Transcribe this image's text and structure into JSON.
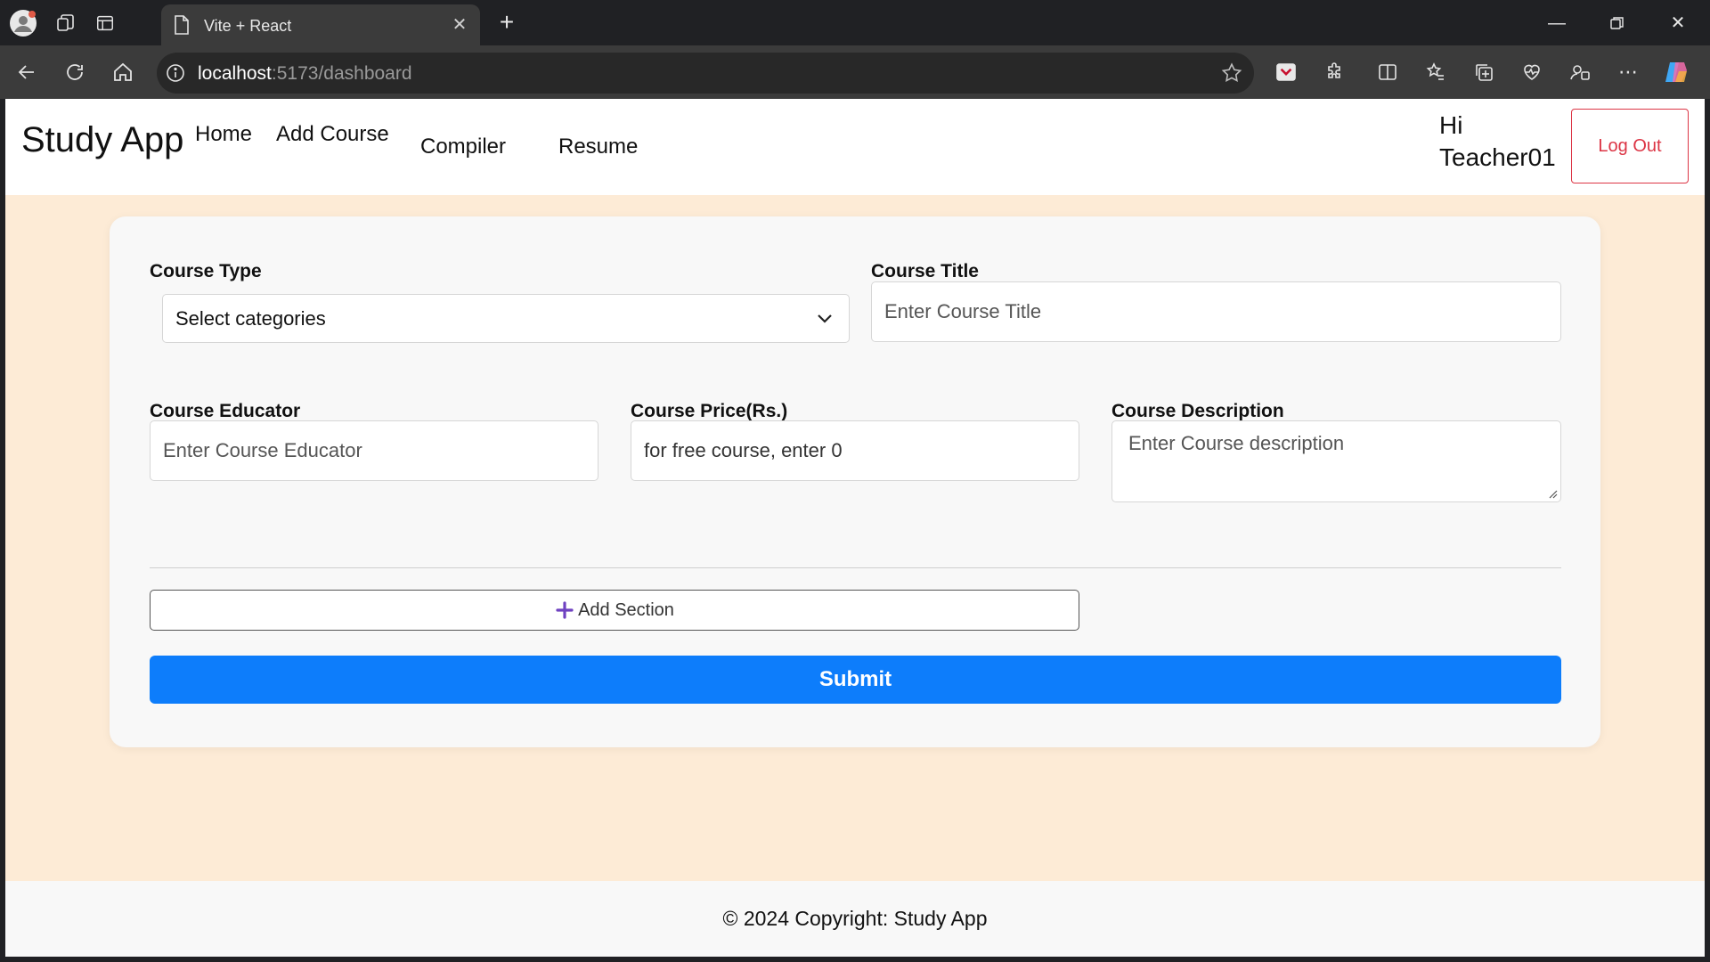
{
  "browser": {
    "tab_title": "Vite + React",
    "url_host": "localhost",
    "url_rest": ":5173/dashboard"
  },
  "navbar": {
    "brand": "Study App",
    "links": [
      "Home",
      "Add Course",
      "Compiler",
      "Resume"
    ],
    "greeting_hi": "Hi",
    "greeting_user": "Teacher01",
    "logout_label": "Log Out"
  },
  "form": {
    "course_type_label": "Course Type",
    "course_type_value": "Select categories",
    "course_title_label": "Course Title",
    "course_title_placeholder": "Enter Course Title",
    "educator_label": "Course Educator",
    "educator_placeholder": "Enter Course Educator",
    "price_label": "Course Price(Rs.)",
    "price_placeholder": "for free course, enter 0",
    "description_label": "Course Description",
    "description_placeholder": "Enter Course description",
    "add_section_label": "Add Section",
    "submit_label": "Submit"
  },
  "footer": {
    "copyright": "© 2024 Copyright: Study App"
  },
  "colors": {
    "page_bg": "#fdebd6",
    "submit_blue": "#0d7dfb",
    "logout_red": "#dc3545",
    "plus_purple": "#6f42c1"
  }
}
